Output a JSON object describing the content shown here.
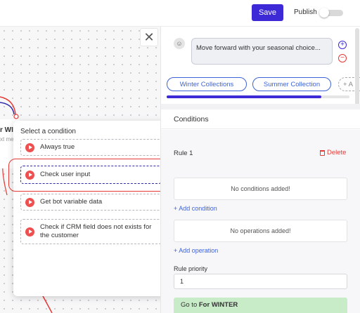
{
  "toolbar": {
    "save_label": "Save",
    "publish_label": "Publish",
    "publish_enabled": false
  },
  "canvas": {
    "partial_node_title": "r WI",
    "partial_node_subtitle": "xt mes"
  },
  "condition_popup": {
    "title": "Select a condition",
    "items": [
      {
        "label": "Always true"
      },
      {
        "label": "Check user input",
        "selected": true
      },
      {
        "label": "Get bot variable data"
      },
      {
        "label": "Check if CRM field does not exists for the customer"
      }
    ]
  },
  "panel": {
    "message_text": "Move forward with your seasonal choice...",
    "chips": [
      "Winter Collections",
      "Summer Collection",
      "+ A"
    ],
    "conditions_title": "Conditions",
    "rule": {
      "label": "Rule 1",
      "delete_label": "Delete",
      "no_conditions_text": "No conditions added!",
      "add_condition_label": "+ Add condition",
      "no_operations_text": "No operations added!",
      "add_operation_label": "+ Add operation",
      "priority_label": "Rule priority",
      "priority_value": "1",
      "goto_prefix": "Go to",
      "goto_target": "For WINTER"
    }
  },
  "colors": {
    "accent": "#3d2ad6",
    "link": "#3d63d6",
    "danger": "#e53935",
    "condition_icon": "#ee4f4f",
    "goto_bg": "#c8ebc8"
  }
}
